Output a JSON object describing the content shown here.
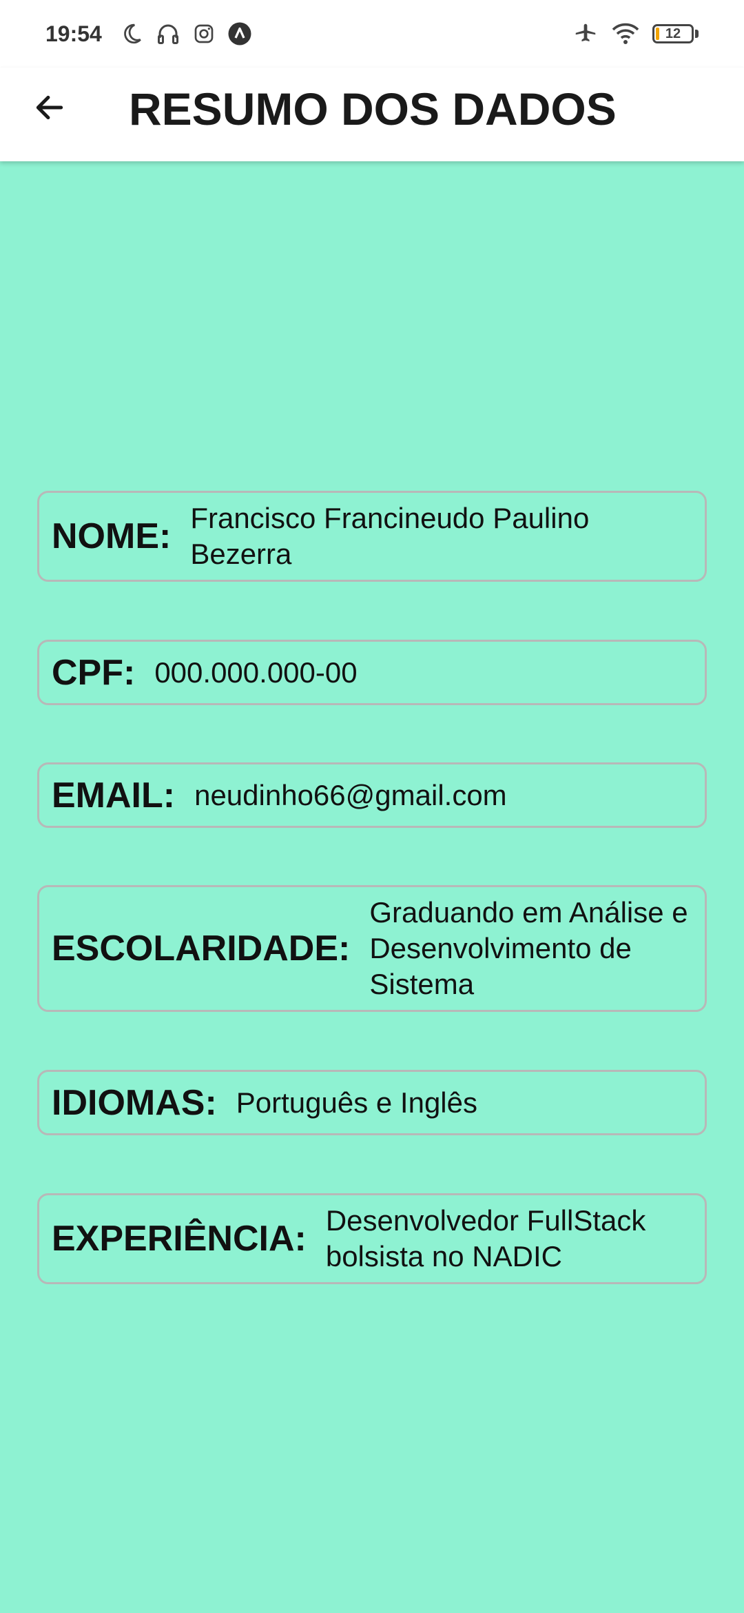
{
  "status_bar": {
    "time": "19:54",
    "left_icons": [
      "moon-icon",
      "headset-icon",
      "instagram-icon",
      "nav-app-icon"
    ],
    "right_icons": [
      "airplane-icon",
      "wifi-icon",
      "battery-icon"
    ],
    "battery_level": "12"
  },
  "app_bar": {
    "back_icon": "arrow-left-icon",
    "title": "RESUMO DOS DADOS"
  },
  "fields": {
    "nome": {
      "label": "NOME:",
      "value": "Francisco Francineudo Paulino Bezerra"
    },
    "cpf": {
      "label": "CPF:",
      "value": "000.000.000-00"
    },
    "email": {
      "label": "EMAIL:",
      "value": "neudinho66@gmail.com"
    },
    "escolaridade": {
      "label": "ESCOLARIDADE:",
      "value": "Graduando em Análise e Desenvolvimento de Sistema"
    },
    "idiomas": {
      "label": "IDIOMAS:",
      "value": "Português e Inglês"
    },
    "experiencia": {
      "label": "EXPERIÊNCIA:",
      "value": "Desenvolvedor FullStack bolsista no NADIC"
    }
  },
  "colors": {
    "background": "#8ef2d2",
    "app_bar": "#ffffff",
    "card_border": "#b8b8b8",
    "battery_accent": "#f2a400"
  }
}
